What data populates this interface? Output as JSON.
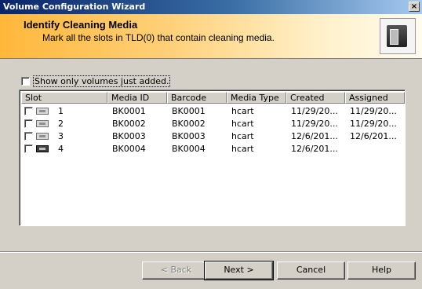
{
  "window": {
    "title": "Volume Configuration Wizard",
    "close_glyph": "×"
  },
  "header": {
    "title": "Identify Cleaning Media",
    "subtitle": "Mark all the slots in TLD(0) that contain cleaning media.",
    "icon": "tape-library-icon"
  },
  "filter": {
    "show_only_label": "Show only volumes just added.",
    "checked": false
  },
  "table": {
    "columns": [
      "Slot",
      "Media ID",
      "Barcode",
      "Media Type",
      "Created",
      "Assigned"
    ],
    "rows": [
      {
        "slot": "1",
        "media_id": "BK0001",
        "barcode": "BK0001",
        "media_type": "hcart",
        "created": "11/29/20...",
        "assigned": "11/29/20...",
        "checked": false
      },
      {
        "slot": "2",
        "media_id": "BK0002",
        "barcode": "BK0002",
        "media_type": "hcart",
        "created": "11/29/20...",
        "assigned": "11/29/20...",
        "checked": false
      },
      {
        "slot": "3",
        "media_id": "BK0003",
        "barcode": "BK0003",
        "media_type": "hcart",
        "created": "12/6/201...",
        "assigned": "12/6/201...",
        "checked": false
      },
      {
        "slot": "4",
        "media_id": "BK0004",
        "barcode": "BK0004",
        "media_type": "hcart",
        "created": "12/6/201...",
        "assigned": "",
        "checked": false
      }
    ]
  },
  "buttons": {
    "back": "< Back",
    "next": "Next >",
    "cancel": "Cancel",
    "help": "Help"
  }
}
